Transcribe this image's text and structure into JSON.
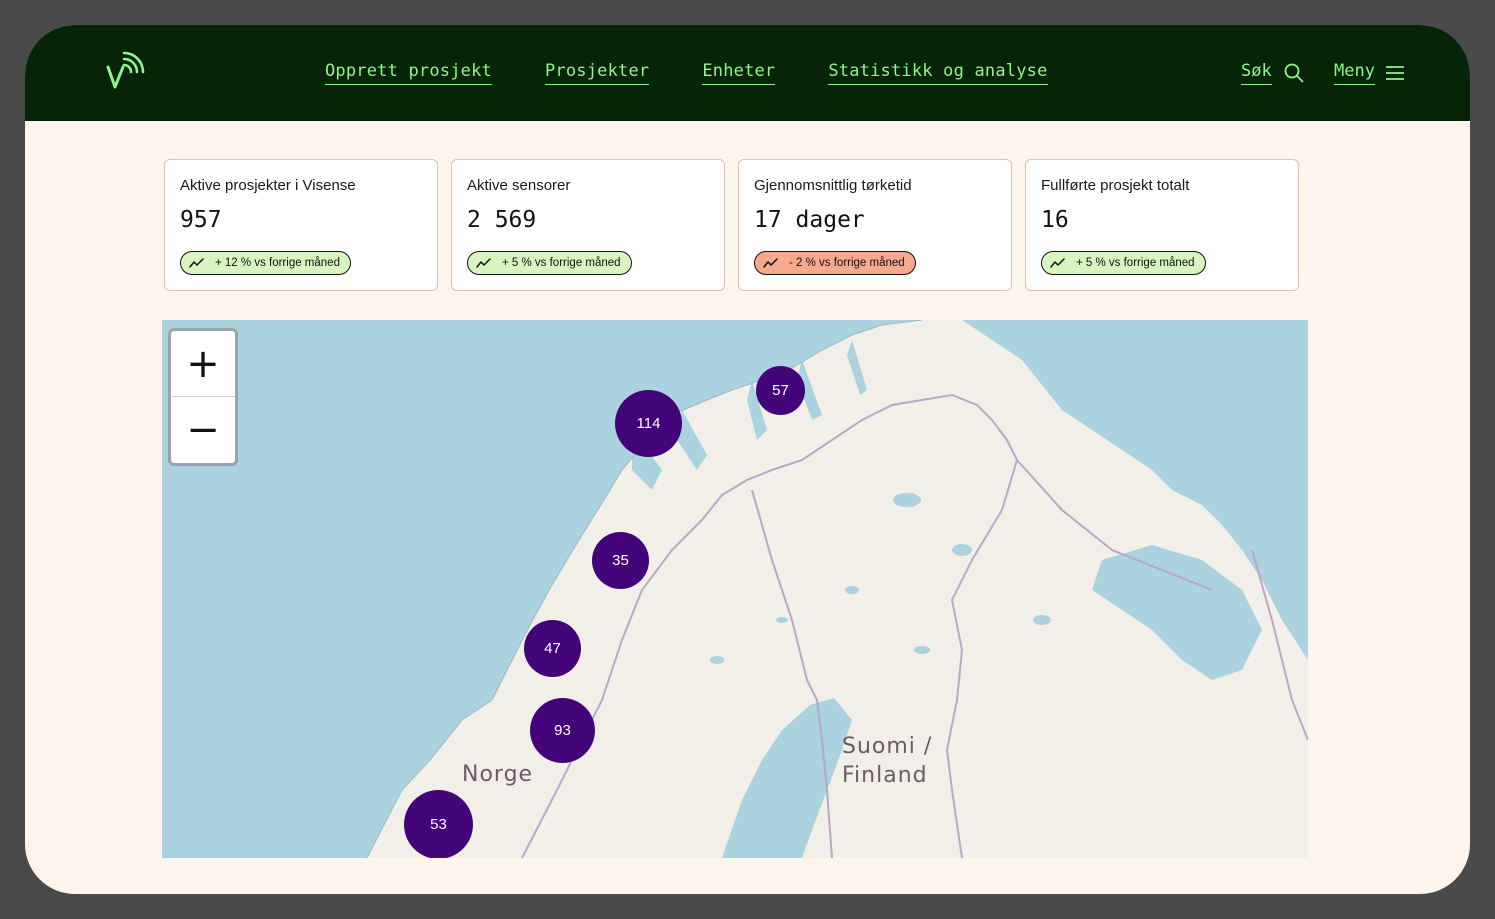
{
  "nav": {
    "links": [
      "Opprett prosjekt",
      "Prosjekter",
      "Enheter",
      "Statistikk og analyse"
    ],
    "search_label": "Søk",
    "menu_label": "Meny"
  },
  "stats": [
    {
      "title": "Aktive prosjekter i Visense",
      "value": "957",
      "trend": "+ 12 % vs forrige måned",
      "trend_direction": "up",
      "badge_color": "#d8f5c0"
    },
    {
      "title": "Aktive sensorer",
      "value": "2 569",
      "trend": "+ 5 % vs forrige måned",
      "trend_direction": "up",
      "badge_color": "#d8f5c0"
    },
    {
      "title": "Gjennomsnittlig tørketid",
      "value": "17 dager",
      "trend": "- 2 % vs forrige måned",
      "trend_direction": "down",
      "badge_color": "#f6a98f"
    },
    {
      "title": "Fullførte prosjekt totalt",
      "value": "16",
      "trend": "+ 5 % vs forrige måned",
      "trend_direction": "up",
      "badge_color": "#d8f5c0"
    }
  ],
  "map": {
    "zoom_in": "+",
    "zoom_out": "−",
    "clusters": [
      "57",
      "114",
      "35",
      "47",
      "93",
      "53"
    ],
    "labels": {
      "norway": "Norge",
      "finland_line1": "Suomi /",
      "finland_line2": "Finland"
    }
  },
  "colors": {
    "header_bg": "#082406",
    "accent": "#8ff58a",
    "page_bg": "#fdf5ec",
    "cluster": "#43047a",
    "water": "#aad3df",
    "land": "#f2efe9"
  }
}
